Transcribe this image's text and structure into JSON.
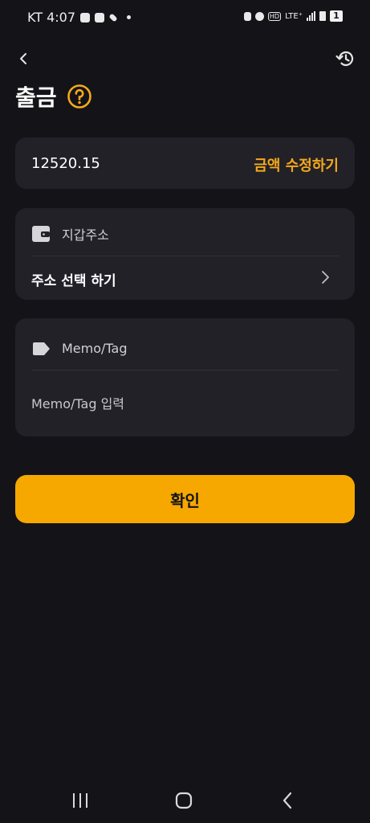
{
  "status_bar": {
    "carrier_time": "KT 4:07",
    "network": "LTE⁺",
    "battery_level": "1"
  },
  "header": {
    "title": "출금"
  },
  "amount": {
    "value": "12520.15",
    "edit_label": "금액 수정하기"
  },
  "address": {
    "label": "지갑주소",
    "select_label": "주소 선택 하기"
  },
  "memo": {
    "label": "Memo/Tag",
    "placeholder": "Memo/Tag 입력"
  },
  "confirm_label": "확인",
  "colors": {
    "background": "#141318",
    "card": "#222128",
    "accent": "#f6a800",
    "accent_text": "#f4a81d"
  },
  "icons": [
    "back-icon",
    "history-icon",
    "help-icon",
    "wallet-icon",
    "chevron-right-icon",
    "tag-icon",
    "recents-icon",
    "home-icon",
    "nav-back-icon"
  ]
}
